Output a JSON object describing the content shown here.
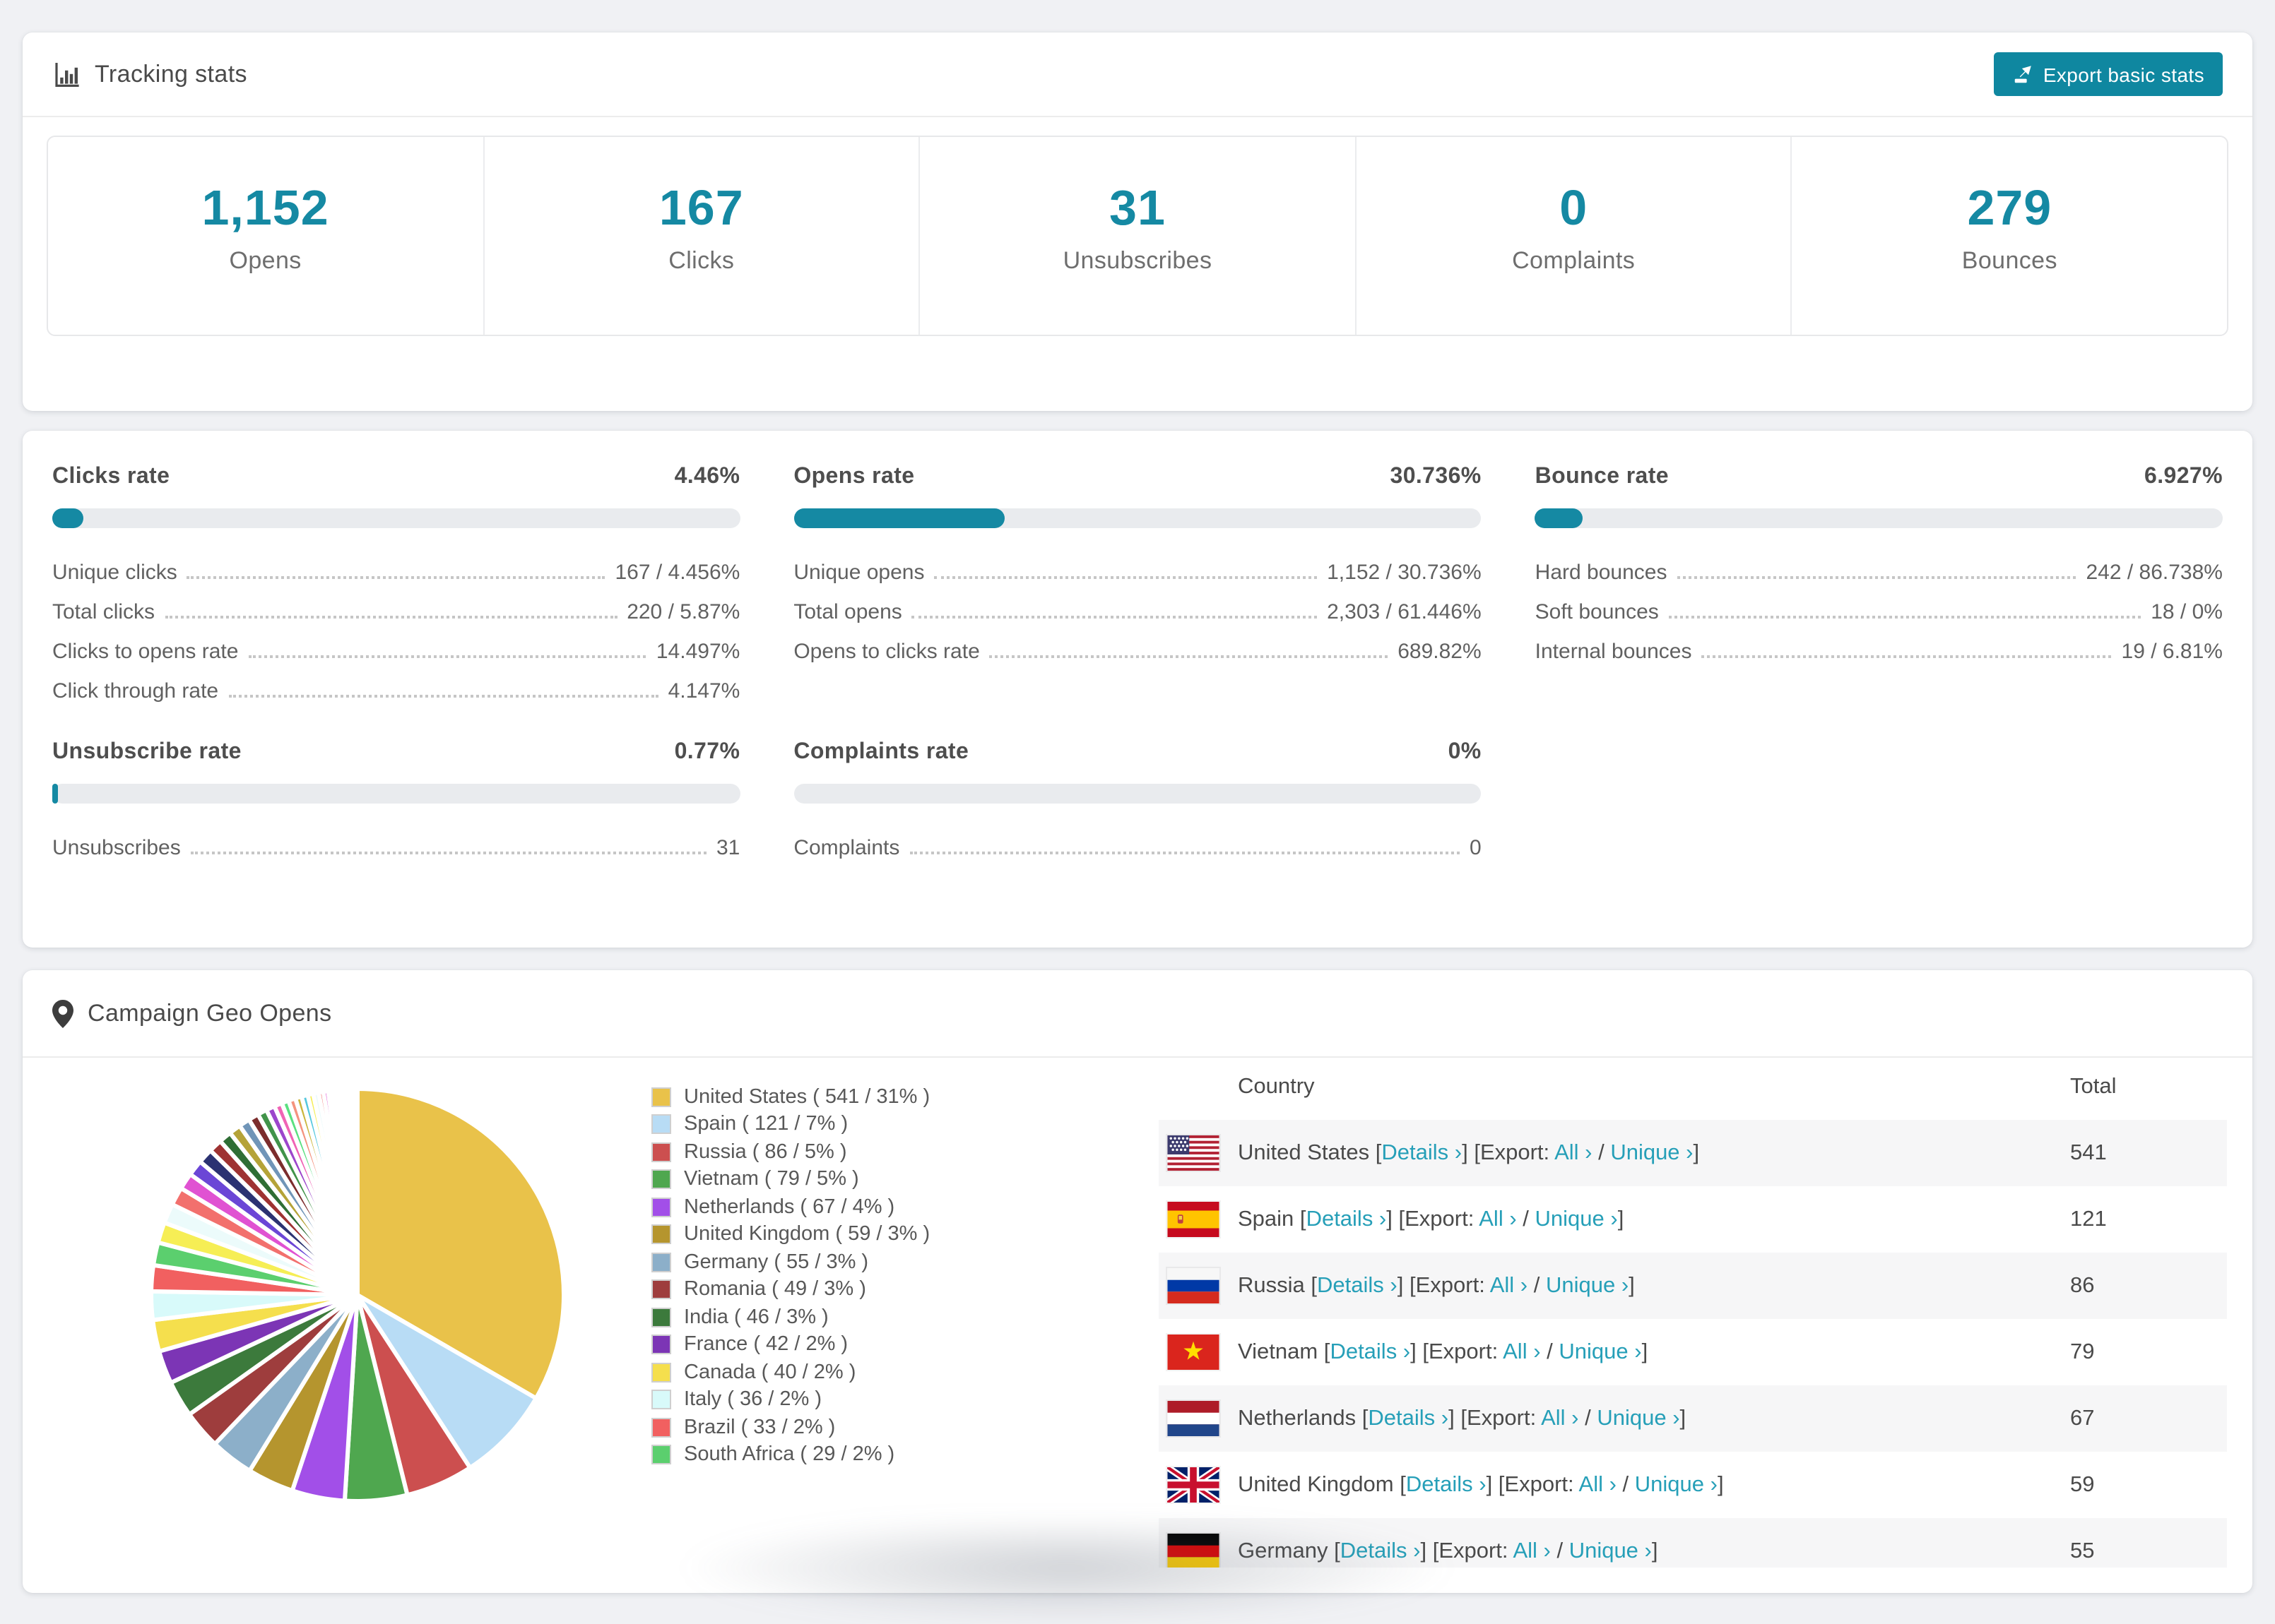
{
  "colors": {
    "accent": "#1589a3",
    "button": "#0f87a0",
    "link": "#269fb8",
    "bar_track": "#e9ebee"
  },
  "tracking": {
    "title": "Tracking stats",
    "export_label": "Export basic stats",
    "stats": [
      {
        "value": "1,152",
        "label": "Opens"
      },
      {
        "value": "167",
        "label": "Clicks"
      },
      {
        "value": "31",
        "label": "Unsubscribes"
      },
      {
        "value": "0",
        "label": "Complaints"
      },
      {
        "value": "279",
        "label": "Bounces"
      }
    ]
  },
  "rates": [
    {
      "title": "Clicks rate",
      "value": "4.46%",
      "percent": 4.46,
      "rows": [
        [
          "Unique clicks",
          "167 / 4.456%"
        ],
        [
          "Total clicks",
          "220 / 5.87%"
        ],
        [
          "Clicks to opens rate",
          "14.497%"
        ],
        [
          "Click through rate",
          "4.147%"
        ]
      ]
    },
    {
      "title": "Opens rate",
      "value": "30.736%",
      "percent": 30.736,
      "rows": [
        [
          "Unique opens",
          "1,152 / 30.736%"
        ],
        [
          "Total opens",
          "2,303 / 61.446%"
        ],
        [
          "Opens to clicks rate",
          "689.82%"
        ]
      ]
    },
    {
      "title": "Bounce rate",
      "value": "6.927%",
      "percent": 6.927,
      "rows": [
        [
          "Hard bounces",
          "242 / 86.738%"
        ],
        [
          "Soft bounces",
          "18 / 0%"
        ],
        [
          "Internal bounces",
          "19 / 6.81%"
        ]
      ]
    },
    {
      "title": "Unsubscribe rate",
      "value": "0.77%",
      "percent": 0.77,
      "rows": [
        [
          "Unsubscribes",
          "31"
        ]
      ]
    },
    {
      "title": "Complaints rate",
      "value": "0%",
      "percent": 0,
      "rows": [
        [
          "Complaints",
          "0"
        ]
      ]
    }
  ],
  "geo": {
    "title": "Campaign Geo Opens",
    "headers": {
      "country": "Country",
      "total": "Total"
    },
    "link_labels": {
      "details": "Details ›",
      "export_label": "Export:",
      "all": "All ›",
      "unique": "Unique ›"
    },
    "rows": [
      {
        "country": "United States",
        "code": "us",
        "total": "541"
      },
      {
        "country": "Spain",
        "code": "es",
        "total": "121"
      },
      {
        "country": "Russia",
        "code": "ru",
        "total": "86"
      },
      {
        "country": "Vietnam",
        "code": "vn",
        "total": "79"
      },
      {
        "country": "Netherlands",
        "code": "nl",
        "total": "67"
      },
      {
        "country": "United Kingdom",
        "code": "gb",
        "total": "59"
      },
      {
        "country": "Germany",
        "code": "de",
        "total": "55"
      }
    ]
  },
  "chart_data": {
    "type": "pie",
    "title": "Campaign Geo Opens",
    "legend_position": "right",
    "start_angle": -90,
    "direction": "clockwise",
    "slices": [
      {
        "label": "United States",
        "value": 541,
        "pct": "31%",
        "color": "#e9c24a"
      },
      {
        "label": "Spain",
        "value": 121,
        "pct": "7%",
        "color": "#b8dcf5"
      },
      {
        "label": "Russia",
        "value": 86,
        "pct": "5%",
        "color": "#cc4f4f"
      },
      {
        "label": "Vietnam",
        "value": 79,
        "pct": "5%",
        "color": "#4fa74f"
      },
      {
        "label": "Netherlands",
        "value": 67,
        "pct": "4%",
        "color": "#a24fe8"
      },
      {
        "label": "United Kingdom",
        "value": 59,
        "pct": "3%",
        "color": "#b5952e"
      },
      {
        "label": "Germany",
        "value": 55,
        "pct": "3%",
        "color": "#8cafc9"
      },
      {
        "label": "Romania",
        "value": 49,
        "pct": "3%",
        "color": "#9e3d3d"
      },
      {
        "label": "India",
        "value": 46,
        "pct": "3%",
        "color": "#3c7a3c"
      },
      {
        "label": "France",
        "value": 42,
        "pct": "2%",
        "color": "#7c35b5"
      },
      {
        "label": "Canada",
        "value": 40,
        "pct": "2%",
        "color": "#f5df4d"
      },
      {
        "label": "Italy",
        "value": 36,
        "pct": "2%",
        "color": "#d8fafa"
      },
      {
        "label": "Brazil",
        "value": 33,
        "pct": "2%",
        "color": "#f16060"
      },
      {
        "label": "South Africa",
        "value": 29,
        "pct": "2%",
        "color": "#5bcf6e"
      }
    ],
    "others": {
      "values": [
        26,
        25,
        23,
        21,
        20,
        19,
        17,
        16,
        15,
        14,
        13,
        12,
        11,
        10,
        9,
        9,
        8,
        8,
        7,
        7,
        6,
        6,
        5,
        5,
        4,
        4,
        3,
        3,
        3,
        2,
        2,
        2,
        1,
        1,
        1,
        1
      ],
      "palette": [
        "#f6ee55",
        "#ecfbfb",
        "#f2706d",
        "#e052d2",
        "#6b46d6",
        "#2b3272",
        "#9e3232",
        "#2f6e35",
        "#b5a338",
        "#7095b8",
        "#7c2d2d",
        "#41934a",
        "#9c46cc",
        "#f063b5",
        "#5ae080",
        "#f4937e",
        "#cbb63d",
        "#56c8de"
      ]
    }
  }
}
